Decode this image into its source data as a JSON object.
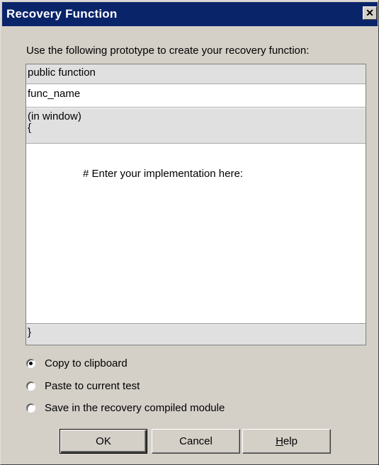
{
  "window": {
    "title": "Recovery Function",
    "close_glyph": "✕"
  },
  "intro_text": "Use the following prototype to create your recovery function:",
  "editor": {
    "header_line": "public function",
    "function_name": "func_name",
    "params_line": "(in window)",
    "open_brace": "{",
    "body_comment": "# Enter your implementation here:",
    "close_brace": "}"
  },
  "options": {
    "selected": "Copy to clipboard",
    "items": [
      {
        "label": "Copy to clipboard"
      },
      {
        "label": "Paste to current test"
      },
      {
        "label": "Save in the recovery compiled module"
      }
    ]
  },
  "buttons": {
    "ok": "OK",
    "cancel": "Cancel",
    "help_mnemonic": "H",
    "help_rest": "elp"
  },
  "colors": {
    "titlebar": "#0a246a",
    "dialog_face": "#d4d0c8",
    "readonly_band": "#e0e0e0"
  }
}
